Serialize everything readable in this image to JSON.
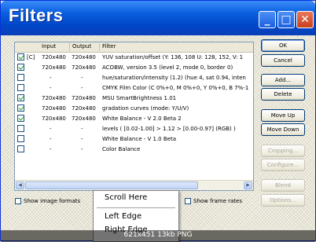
{
  "window": {
    "title": "Filters"
  },
  "titlebar_buttons": {
    "minimize": "_",
    "maximize": "□",
    "close": "✕"
  },
  "list": {
    "headers": {
      "input": "Input",
      "output": "Output",
      "filter": "Filter"
    },
    "rows": [
      {
        "checked": true,
        "flag": "[C]",
        "input": "720x480",
        "output": "720x480",
        "filter": "YUV saturation/offset (Y: 136, 108 U: 128, 152, V: 1"
      },
      {
        "checked": true,
        "flag": "",
        "input": "720x480",
        "output": "720x480",
        "filter": "ACOBW, version 3.5 (level 2, mode 0, border 0)"
      },
      {
        "checked": false,
        "flag": "",
        "input": "-",
        "output": "-",
        "filter": "hue/saturation/intensity (1.2) (hue 4, sat 0.94, inten"
      },
      {
        "checked": false,
        "flag": "",
        "input": "-",
        "output": "-",
        "filter": "CMYK Film Color (C 0%+0, M 0%+0, Y 0%+0, B 7%-1"
      },
      {
        "checked": true,
        "flag": "",
        "input": "720x480",
        "output": "720x480",
        "filter": "MSU SmartBrightness 1.01"
      },
      {
        "checked": true,
        "flag": "",
        "input": "720x480",
        "output": "720x480",
        "filter": "gradation curves (mode: Y/U/V)"
      },
      {
        "checked": true,
        "flag": "",
        "input": "720x480",
        "output": "720x480",
        "filter": "White Balance - V 2.0 Beta 2"
      },
      {
        "checked": false,
        "flag": "",
        "input": "-",
        "output": "-",
        "filter": "levels ( [0.02-1.00] > 1.12 > [0.00-0.97] (RGB) )"
      },
      {
        "checked": false,
        "flag": "",
        "input": "-",
        "output": "-",
        "filter": "White Balance - V 1.0 Beta"
      },
      {
        "checked": false,
        "flag": "",
        "input": "-",
        "output": "-",
        "filter": "Color Balance"
      }
    ]
  },
  "buttons": {
    "ok": "OK",
    "cancel": "Cancel",
    "add": "Add...",
    "delete": "Delete",
    "move_up": "Move Up",
    "move_down": "Move Down",
    "cropping": "Cropping...",
    "configure": "Configure...",
    "blend": "Blend",
    "options": "Options..."
  },
  "options": {
    "show_image_formats": "Show image formats",
    "show_frame_rates": "Show frame rates"
  },
  "context_menu": {
    "scroll_here": "Scroll Here",
    "left_edge": "Left Edge",
    "right_edge": "Right Edge"
  },
  "status_bar": "621x451  13kb  PNG"
}
